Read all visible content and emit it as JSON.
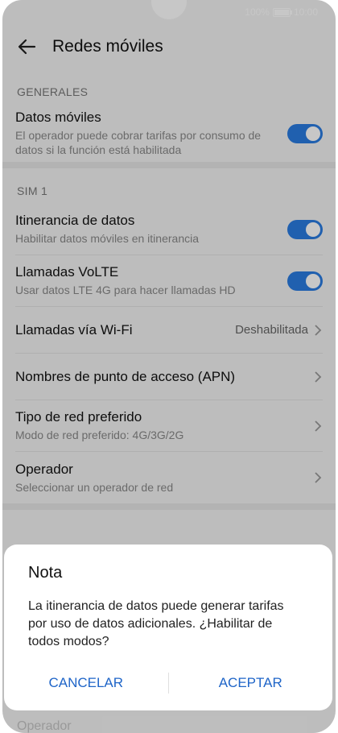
{
  "status_bar": {
    "battery": "100%",
    "time": "10:00"
  },
  "app_bar": {
    "title": "Redes móviles"
  },
  "sections": {
    "general": {
      "header": "GENERALES",
      "mobile_data": {
        "title": "Datos móviles",
        "subtitle": "El operador puede cobrar tarifas por consumo de datos si la función está habilitada",
        "toggle": "on"
      }
    },
    "sim1": {
      "header": "SIM 1",
      "roaming": {
        "title": "Itinerancia de datos",
        "subtitle": "Habilitar datos móviles en itinerancia",
        "toggle": "on"
      },
      "volte": {
        "title": "Llamadas VoLTE",
        "subtitle": "Usar datos LTE 4G para hacer llamadas HD",
        "toggle": "on"
      },
      "wifi_calls": {
        "title": "Llamadas vía Wi-Fi",
        "value": "Deshabilitada"
      },
      "apn": {
        "title": "Nombres de punto de acceso (APN)"
      },
      "network_type": {
        "title": "Tipo de red preferido",
        "subtitle": "Modo de red preferido: 4G/3G/2G"
      },
      "operator": {
        "title": "Operador",
        "subtitle": "Seleccionar un operador de red"
      }
    },
    "sim2": {
      "peek_operator": "Operador"
    }
  },
  "dialog": {
    "title": "Nota",
    "body": "La itinerancia de datos puede generar tarifas por uso de datos adicionales. ¿Habilitar de todos modos?",
    "cancel_label": "CANCELAR",
    "accept_label": "ACEPTAR"
  },
  "colors": {
    "accent": "#2a7be0",
    "dialog_button": "#1f65c8"
  }
}
